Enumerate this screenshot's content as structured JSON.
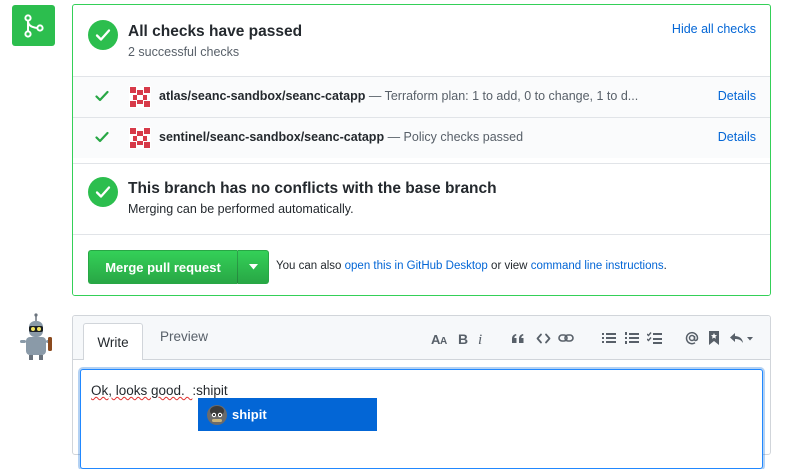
{
  "status": {
    "title": "All checks have passed",
    "subtitle": "2 successful checks",
    "hide_label": "Hide all checks",
    "checks": [
      {
        "context": "atlas/seanc-sandbox/seanc-catapp",
        "description": "— Terraform plan: 1 to add, 0 to change, 1 to d...",
        "details": "Details"
      },
      {
        "context": "sentinel/seanc-sandbox/seanc-catapp",
        "description": "— Policy checks passed",
        "details": "Details"
      }
    ],
    "conflict_title": "This branch has no conflicts with the base branch",
    "conflict_subtitle": "Merging can be performed automatically."
  },
  "merge": {
    "button_label": "Merge pull request",
    "note_prefix": "You can also",
    "desktop_link": "open this in GitHub Desktop",
    "note_middle": "or view",
    "cli_link": "command line instructions",
    "note_suffix": "."
  },
  "editor": {
    "tab_write": "Write",
    "tab_preview": "Preview",
    "text_before": "Ok, looks good.  ",
    "text_typed": ":shipit",
    "suggestion": "shipit"
  },
  "icons": {
    "merge": "git-merge-icon",
    "check": "check-icon",
    "heading": "heading-icon",
    "bold": "bold-icon",
    "italic": "italic-icon",
    "quote": "quote-icon",
    "code": "code-icon",
    "link": "link-icon",
    "bullet_list": "bullet-list-icon",
    "numbered_list": "numbered-list-icon",
    "task_list": "task-list-icon",
    "mention": "mention-icon",
    "bookmark": "bookmark-icon",
    "reply": "reply-icon"
  },
  "colors": {
    "success": "#2cbe4e",
    "link": "#0366d6",
    "border_success": "#34d058",
    "suggestion_bg": "#0366d6"
  }
}
